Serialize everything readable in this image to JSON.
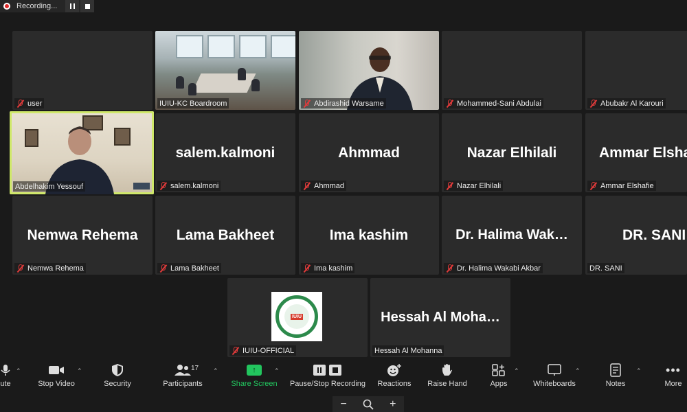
{
  "recording": {
    "label": "Recording..."
  },
  "tiles": [
    {
      "name": "user",
      "big": ""
    },
    {
      "name": "IUIU-KC Boardroom",
      "big": ""
    },
    {
      "name": "Abdirashid Warsame",
      "big": ""
    },
    {
      "name": "Mohammed-Sani Abdulai",
      "big": ""
    },
    {
      "name": "Abubakr Al Karouri",
      "big": ""
    },
    {
      "name": "Abdelhakim Yessouf",
      "big": ""
    },
    {
      "name": "salem.kalmoni",
      "big": "salem.kalmoni"
    },
    {
      "name": "Ahmmad",
      "big": "Ahmmad"
    },
    {
      "name": "Nazar Elhilali",
      "big": "Nazar Elhilali"
    },
    {
      "name": "Ammar Elshafie",
      "big": "Ammar Elsha"
    },
    {
      "name": "Nemwa Rehema",
      "big": "Nemwa Rehema"
    },
    {
      "name": "Lama Bakheet",
      "big": "Lama Bakheet"
    },
    {
      "name": "Ima kashim",
      "big": "Ima kashim"
    },
    {
      "name": "Dr. Halima Wakabi Akbar",
      "big": "Dr.  Halima  Wak…"
    },
    {
      "name": "DR. SANI",
      "big": "DR. SANI"
    },
    {
      "name": "IUIU-OFFICIAL",
      "big": ""
    },
    {
      "name": "Hessah Al Mohanna",
      "big": "Hessah  Al  Moha…"
    }
  ],
  "toolbar": {
    "mute": "ute",
    "stop_video": "Stop Video",
    "security": "Security",
    "participants": "Participants",
    "participants_count": "17",
    "share_screen": "Share Screen",
    "pause_stop_recording": "Pause/Stop Recording",
    "reactions": "Reactions",
    "raise_hand": "Raise Hand",
    "apps": "Apps",
    "whiteboards": "Whiteboards",
    "notes": "Notes",
    "more": "More"
  },
  "zoom": {
    "minus": "−",
    "plus": "+"
  },
  "colors": {
    "active_speaker": "#cfe86a",
    "share_green": "#22c55e",
    "muted_red": "#e23b3b",
    "recording_red": "#e02828"
  }
}
